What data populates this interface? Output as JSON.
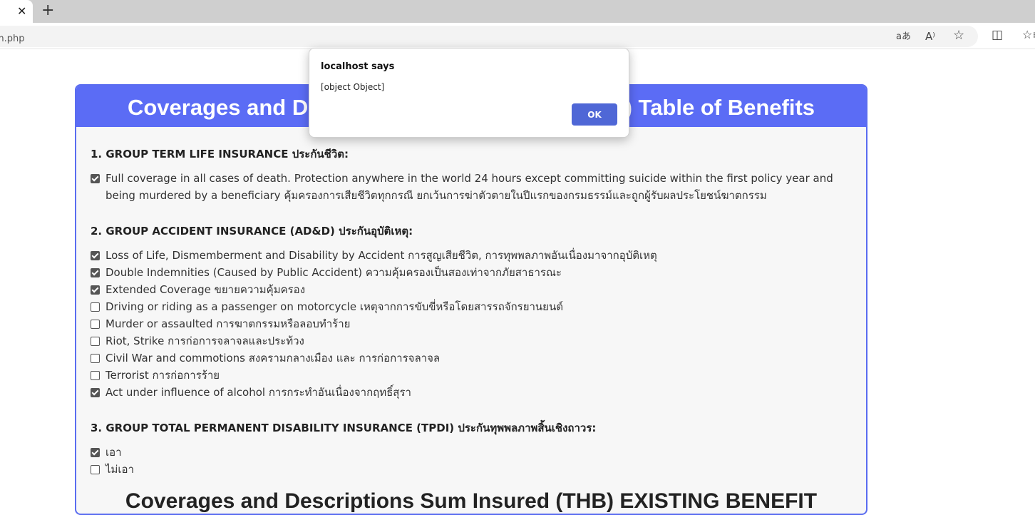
{
  "browser": {
    "tab_close": "✕",
    "new_tab": "+",
    "url": "rom.php",
    "toolbar_icons": {
      "translate": "aあ",
      "read_aloud": "A⁾",
      "favorite": "☆",
      "split": "◫",
      "favorites_list": "☆≡"
    }
  },
  "page": {
    "header_title": "Coverages and Descriptions Sum Insured (THB) Table of Benefits",
    "sections": [
      {
        "title": "1. GROUP TERM LIFE INSURANCE ประกันชีวิต:",
        "items": [
          {
            "label": "Full coverage in all cases of death. Protection anywhere in the world 24 hours except committing suicide within the first policy year and being murdered by a beneficiary คุ้มครองการเสียชีวิตทุกกรณี ยกเว้นการฆ่าตัวตายในปีแรกของกรมธรรม์และถูกผู้รับผลประโยชน์ฆาตกรรม",
            "checked": true
          }
        ]
      },
      {
        "title": "2. GROUP ACCIDENT INSURANCE (AD&D) ประกันอุบัติเหตุ:",
        "items": [
          {
            "label": "Loss of Life, Dismemberment and Disability by Accident การสูญเสียชีวิต, การทุพพลภาพอันเนื่องมาจากอุบัติเหตุ",
            "checked": true
          },
          {
            "label": "Double Indemnities (Caused by Public Accident) ความคุ้มครองเป็นสองเท่าจากภัยสาธารณะ",
            "checked": true
          },
          {
            "label": "Extended Coverage ขยายความคุ้มครอง",
            "checked": true
          },
          {
            "label": "Driving or riding as a passenger on motorcycle เหตุจากการขับขี่หรือโดยสารรถจักรยานยนต์",
            "checked": false
          },
          {
            "label": "Murder or assaulted การฆาตกรรมหรือลอบทำร้าย",
            "checked": false
          },
          {
            "label": "Riot, Strike การก่อการจลาจลและประท้วง",
            "checked": false
          },
          {
            "label": "Civil War and commotions สงครามกลางเมือง และ การก่อการจลาจล",
            "checked": false
          },
          {
            "label": "Terrorist การก่อการร้าย",
            "checked": false
          },
          {
            "label": "Act under influence of alcohol การกระทำอันเนื่องจากฤทธิ์สุรา",
            "checked": true
          }
        ]
      },
      {
        "title": "3. GROUP TOTAL PERMANENT DISABILITY INSURANCE (TPDI) ประกันทุพพลภาพสิ้นเชิงถาวร:",
        "items": [
          {
            "label": "เอา",
            "checked": true
          },
          {
            "label": "ไม่เอา",
            "checked": false
          }
        ]
      }
    ],
    "bottom_title": "Coverages and Descriptions Sum Insured (THB) EXISTING BENEFIT"
  },
  "dialog": {
    "title": "localhost says",
    "message": "[object Object]",
    "ok_label": "OK"
  }
}
